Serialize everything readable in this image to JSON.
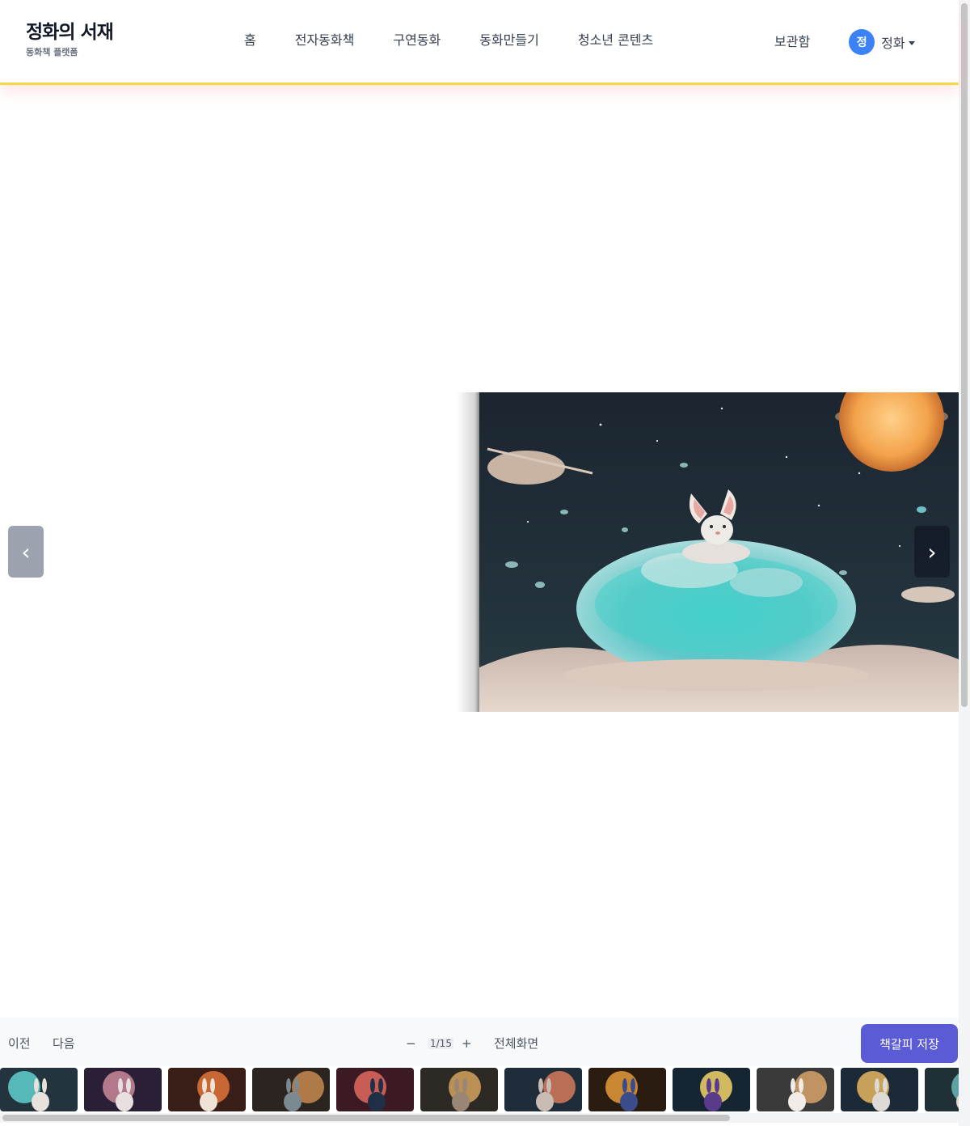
{
  "brand": {
    "title": "정화의 서재",
    "subtitle": "동화책 플랫폼"
  },
  "nav": {
    "items": [
      "홈",
      "전자동화책",
      "구연동화",
      "동화만들기",
      "청소년 콘텐츠"
    ]
  },
  "header_right": {
    "locker": "보관함",
    "user_initial": "정",
    "user_name": "정화"
  },
  "viewer": {
    "prev_icon": "‹",
    "next_icon": "›",
    "page_illustration": "rabbit-on-glowing-moon"
  },
  "toolbar": {
    "prev": "이전",
    "next": "다음",
    "zoom_out": "−",
    "page_counter": "1/15",
    "zoom_in": "+",
    "fullscreen": "전체화면",
    "bookmark": "책갈피 저장"
  },
  "thumbnails": {
    "count": 12
  },
  "colors": {
    "accent": "#5b5bd6",
    "avatar": "#3b82f6",
    "header_border": "#f8d848"
  }
}
